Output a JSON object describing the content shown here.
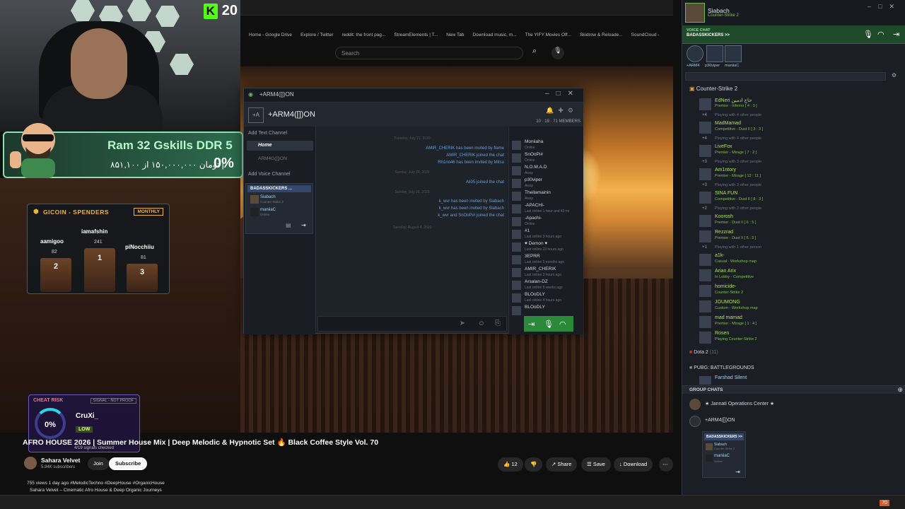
{
  "stream": {
    "kick_viewers": "20",
    "kick_logo": "K"
  },
  "ram_banner": {
    "title": "Ram 32 Gskills DDR 5",
    "price": "تومان ۱۵۰,۰۰۰,۰۰۰ از ۸۵۱,۱۰۰ |",
    "percent": "0%"
  },
  "gicoin": {
    "title": "GICOIN - SPENDERS",
    "period": "MONTHLY",
    "first": {
      "name": "iamafshin",
      "score": "241",
      "rank": "1"
    },
    "second": {
      "name": "aamigoo",
      "score": "82",
      "rank": "2"
    },
    "third": {
      "name": "piNocchiiu",
      "score": "81",
      "rank": "3"
    }
  },
  "cheat_risk": {
    "title": "CHEAT RISK",
    "signal": "SIGNAL - NOT PROOF",
    "percent": "0%",
    "user": "CruXi_",
    "level": "LOW",
    "signals": "4/19 signals checked"
  },
  "browser": {
    "bookmarks": [
      "Home - Google Drive",
      "Explore / Twitter",
      "reddit: the front pag...",
      "StreamElements | T...",
      "New Tab",
      "Download music, m...",
      "The YIFY Movies Off...",
      "Skidrow & Reloade...",
      "SoundCloud -"
    ],
    "search_placeholder": "Search"
  },
  "video": {
    "title": "AFRO HOUSE 2026 | Summer House Mix | Deep Melodic & Hypnotic Set 🔥 Black Coffee Style Vol. 70",
    "channel": "Sahara Velvet",
    "subscribers": "5.94K subscribers",
    "join": "Join",
    "subscribe": "Subscribe",
    "likes": "12",
    "share": "Share",
    "save": "Save",
    "download": "Download",
    "views": "755 views  1 day ago  #MelodicTechno #DeepHouse #OrganicHouse",
    "description": "Sahara Velvet – Cinematic Afro House & Deep Organic Journeys"
  },
  "chat_window": {
    "tab_title": "+ARM4([])ON",
    "group_name": "+ARM4([])ON",
    "stats": "10 · 19 · 71 MEMBERS",
    "add_text_channel": "Add Text Channel",
    "home": "Home",
    "text_channel": "ARM4G([])ON",
    "add_voice_channel": "Add Voice Channel",
    "voice_channel": "BADASSKICKERS ...",
    "voice_users": [
      {
        "name": "Siabach",
        "sub": "Counter-Strike 2"
      },
      {
        "name": "maniiaC",
        "sub": "Online"
      }
    ],
    "messages": [
      {
        "date": "Tuesday, July 21, 2020"
      },
      {
        "text": "AMIR_CHERIK has been invited by flame"
      },
      {
        "text": "AMIR_CHERIK joined the chat"
      },
      {
        "text": "Rh1no46 has been invited by Mitsu"
      },
      {
        "date": "Sunday, July 26, 2020"
      },
      {
        "text": "Ali05 joined the chat"
      },
      {
        "date": "Sunday, July 26, 2020"
      },
      {
        "text": "k_wvr has been invited by Siabach"
      },
      {
        "text": "k_wvr has been invited by Siabach"
      },
      {
        "text": "k_wvr and SnOoPi# joined the chat"
      },
      {
        "date": "Tuesday, August 4, 2020"
      }
    ],
    "members": [
      {
        "name": "Moniiaha",
        "status": "Online"
      },
      {
        "name": "SnOoPi#",
        "status": "Online"
      },
      {
        "name": "N.O.M.A.D",
        "status": "Away"
      },
      {
        "name": "p30viper",
        "status": "Away"
      },
      {
        "name": "Theilamainin",
        "status": "Away"
      },
      {
        "name": "-APACHI-",
        "status": "Last online 1 hour and 43 mi"
      },
      {
        "name": "-Apachi-",
        "status": "Online"
      },
      {
        "name": "#1",
        "status": "Last online 3 hours ago"
      },
      {
        "name": "♥ Demon ♥",
        "status": "Last online 23 hours ago"
      },
      {
        "name": "3EPRR",
        "status": "Last online 5 months ago"
      },
      {
        "name": "AMIR_CHERIK",
        "status": "Last online 3 hours ago"
      },
      {
        "name": "Arsalan-DZ",
        "status": "Last online 8 weeks ago"
      },
      {
        "name": "BLOoDLY",
        "status": "Last online 4 hours ago"
      },
      {
        "name": "BLOoDLY",
        "status": ""
      }
    ]
  },
  "friends": {
    "self_name": "Siabach",
    "self_game": "Counter-Strike 2",
    "voice_label": "VOICE CHAT",
    "voice_group": "BADASSKICKERS >>",
    "voice_users": [
      "+ARM4",
      "p30viper",
      "maniiaC"
    ],
    "game_header": "Counter-Strike 2",
    "friends": [
      {
        "name": "EdNeri حاج ادمین",
        "status": "Premier - Inferno [ 4 : 3 ]",
        "more_n": "+4",
        "more": "Playing with 4 other people"
      },
      {
        "name": "MadMamad",
        "status": "Competitive - Dust II [ 3 : 3 ]",
        "more_n": "+4",
        "more": "Playing with 4 other people"
      },
      {
        "name": "LiveFox",
        "status": "Premier - Mirage [ 7 : 2 ]",
        "more_n": "+3",
        "more": "Playing with 3 other people"
      },
      {
        "name": "Am1ntory",
        "status": "Premier - Mirage [ 12 : 11 ]",
        "more_n": "+3",
        "more": "Playing with 3 other people"
      },
      {
        "name": "SINA FUN",
        "status": "Competitive - Dust II [ 8 : 3 ]",
        "more_n": "+2",
        "more": "Playing with 2 other people"
      },
      {
        "name": "Koorosh",
        "status": "Premier - Dust II [ 6 : 5 ]",
        "more_n": "",
        "more": ""
      },
      {
        "name": "Rezzrad",
        "status": "Premier - Dust II [ 6 : 5 ]",
        "more_n": "+1",
        "more": "Playing with 1 other person"
      },
      {
        "name": "a1k-",
        "status": "Casual - Workshop map",
        "more_n": "",
        "more": ""
      },
      {
        "name": "Arian Arix",
        "status": "In Lobby - Competitive",
        "more_n": "",
        "more": ""
      },
      {
        "name": "homicide-",
        "status": "Counter-Strike 2",
        "more_n": "",
        "more": ""
      },
      {
        "name": "JOUMONG",
        "status": "Custom - Workshop map",
        "more_n": "",
        "more": ""
      },
      {
        "name": "mad mamad",
        "status": "Premier - Mirage [ 1 : 4 ]",
        "more_n": "",
        "more": ""
      },
      {
        "name": "Rosen",
        "status": "Playing Counter-Strike 2",
        "more_n": "",
        "more": ""
      }
    ],
    "dota": "Dota 2",
    "dota_count": "(11)",
    "pubg": "PUBG: BATTLEGROUNDS",
    "pubg_friend": "Farshad Silent",
    "group_chats": "GROUP CHATS",
    "group_list": [
      "★ Jannati Operations Center ★",
      "+ARM4([])ON"
    ],
    "gc_voice_group": "BADASSKICKERS >>",
    "gc_voice_users": [
      {
        "name": "Siabach",
        "sub": "Counter-Strike 2"
      },
      {
        "name": "maniiaC",
        "sub": "Online"
      }
    ]
  },
  "taskbar": {
    "notification_count": "70"
  }
}
